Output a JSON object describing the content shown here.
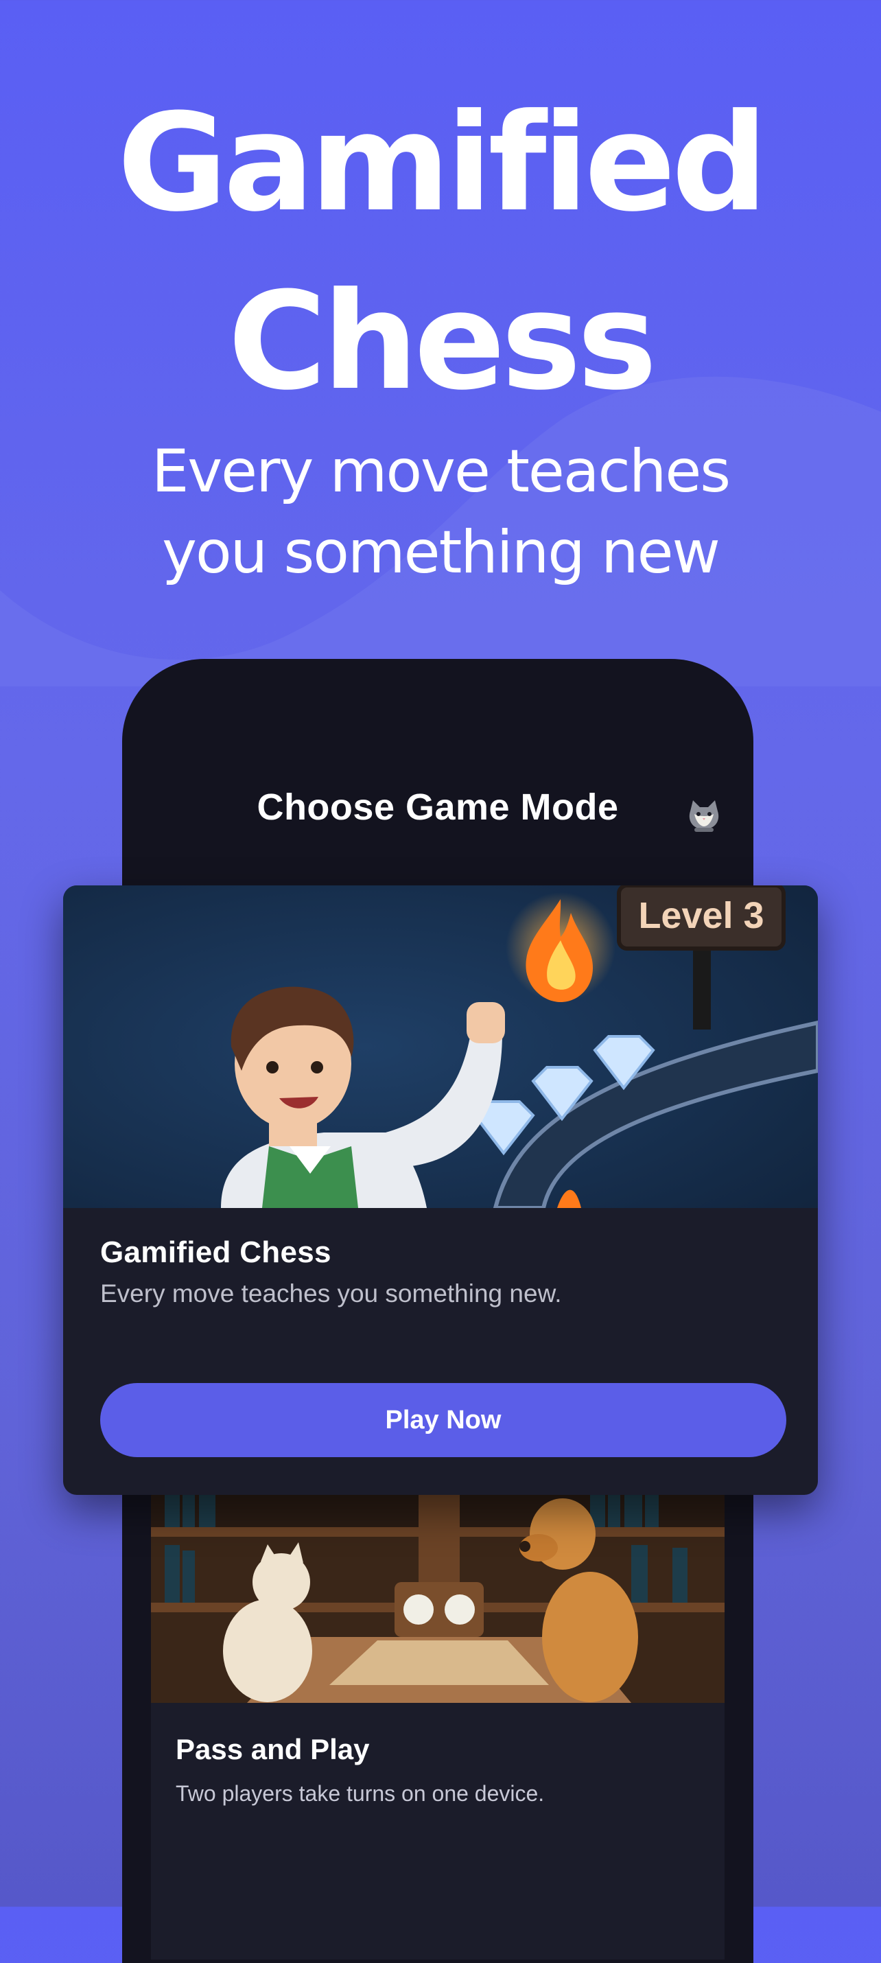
{
  "hero": {
    "title_line1": "Gamified",
    "title_line2": "Chess",
    "subtitle_line1": "Every move teaches",
    "subtitle_line2": "you something new"
  },
  "phone": {
    "header_title": "Choose Game Mode",
    "avatar_icon": "cat-avatar-icon"
  },
  "featured_card": {
    "level_badge": "Level 3",
    "title": "Gamified Chess",
    "description": "Every move teaches you something new.",
    "button_label": "Play Now"
  },
  "second_card": {
    "title": "Pass and Play",
    "description": "Two players take turns on one device."
  },
  "colors": {
    "background": "#5a5ff4",
    "accent": "#5b5ee8",
    "card": "#1b1c2a",
    "phone": "#13131f"
  }
}
